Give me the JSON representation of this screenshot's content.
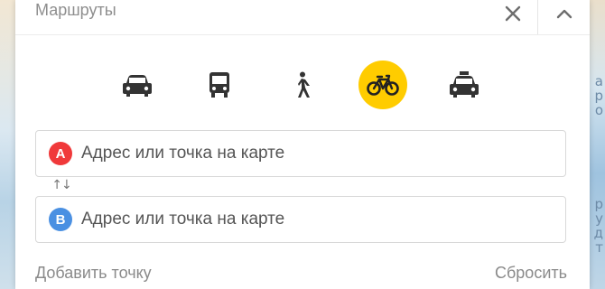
{
  "panel": {
    "title": "Маршруты"
  },
  "header": {
    "close_icon": "close-icon",
    "collapse_icon": "chevron-up-icon"
  },
  "modes": [
    {
      "id": "car",
      "icon": "car-icon",
      "active": false
    },
    {
      "id": "transit",
      "icon": "bus-icon",
      "active": false
    },
    {
      "id": "walk",
      "icon": "pedestrian-icon",
      "active": false
    },
    {
      "id": "bike",
      "icon": "bicycle-icon",
      "active": true
    },
    {
      "id": "taxi",
      "icon": "taxi-icon",
      "active": false
    }
  ],
  "route": {
    "from": {
      "marker": "A",
      "placeholder": "Адрес или точка на карте",
      "value": ""
    },
    "to": {
      "marker": "B",
      "placeholder": "Адрес или точка на карте",
      "value": ""
    },
    "swap_label": "↑↓"
  },
  "footer": {
    "add_point": "Добавить точку",
    "reset": "Сбросить"
  },
  "map_labels": [
    "а",
    "р",
    "о",
    "р",
    "у",
    "д",
    "т"
  ],
  "colors": {
    "accent": "#ffcc00",
    "marker_a": "#f0393a",
    "marker_b": "#4a90e2",
    "icon_dark": "#333333"
  }
}
